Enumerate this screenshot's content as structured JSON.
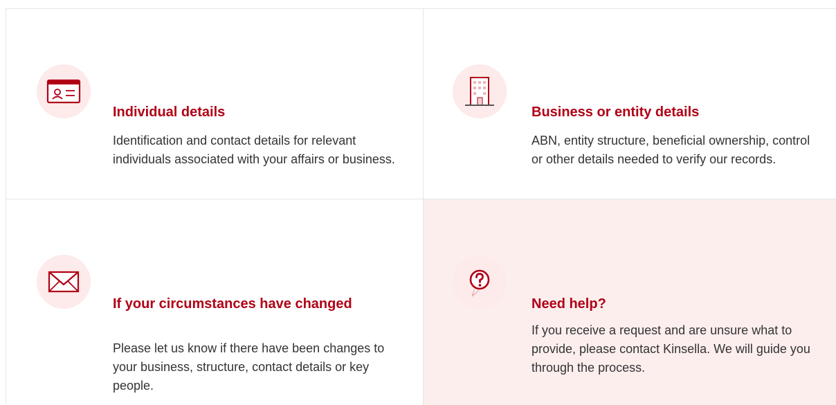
{
  "colors": {
    "accent": "#b00016",
    "icon_bg": "#fdeaea",
    "highlight_card_bg": "#fdeeee",
    "text": "#333333",
    "border": "#e6e6e6"
  },
  "cards": [
    {
      "icon": "id-card-icon",
      "title": "Individual details",
      "description": "Identification and contact details for relevant individuals associated with your affairs or business."
    },
    {
      "icon": "building-icon",
      "title": "Business or entity details",
      "description": "ABN, entity structure, beneficial ownership, control or other details needed to verify our records."
    },
    {
      "icon": "envelope-icon",
      "title": "If your circumstances have changed",
      "description": "Please let us know if there have been changes to your business, structure, contact details or key people."
    },
    {
      "icon": "help-question-icon",
      "title": "Need help?",
      "description": "If you receive a request and are unsure what to provide, please contact Kinsella. We will guide you through the process."
    }
  ]
}
